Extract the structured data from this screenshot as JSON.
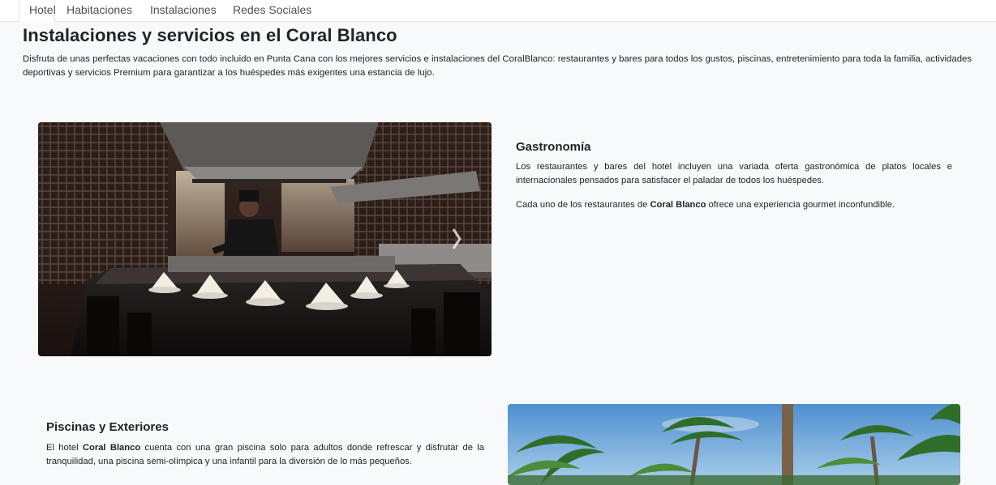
{
  "nav": {
    "tabs": [
      {
        "label": "Hotel"
      },
      {
        "label": "Habitaciones"
      },
      {
        "label": "Instalaciones"
      },
      {
        "label": "Redes Sociales"
      }
    ]
  },
  "header": {
    "title": "Instalaciones y servicios en el Coral Blanco",
    "intro": "Disfruta de unas perfectas vacaciones con todo incluido en Punta Cana con los mejores servicios e instalaciones del CoralBlanco: restaurantes y bares para todos los gustos, piscinas, entretenimiento para toda la familia, actividades deportivas y servicios Premium para garantizar a los huéspedes más exigentes una estancia de lujo."
  },
  "sections": [
    {
      "title": "Gastronomía",
      "p1": "Los restaurantes y bares del hotel incluyen una variada oferta gastronómica de platos locales e internacionales pensados para satisfacer el paladar de todos los huéspedes.",
      "p2_before": "Cada uno de los restaurantes de ",
      "p2_bold": "Coral Blanco",
      "p2_after": " ofrece una experiencia gourmet inconfundible."
    },
    {
      "title": "Piscinas y Exteriores",
      "p1_before": "El hotel ",
      "p1_bold": "Coral Blanco",
      "p1_after": " cuenta con una gran piscina solo para adultos donde refrescar y disfrutar de la tranquilidad, una piscina semi-olímpica y una infantil para la diversión de lo más pequeños."
    }
  ],
  "colors": {
    "page_bg": "#f8f9fa",
    "nav_bg": "#ffffff",
    "text": "#212529",
    "nav_text": "#495057"
  },
  "icons": {
    "carousel_next": "chevron-right-icon"
  }
}
